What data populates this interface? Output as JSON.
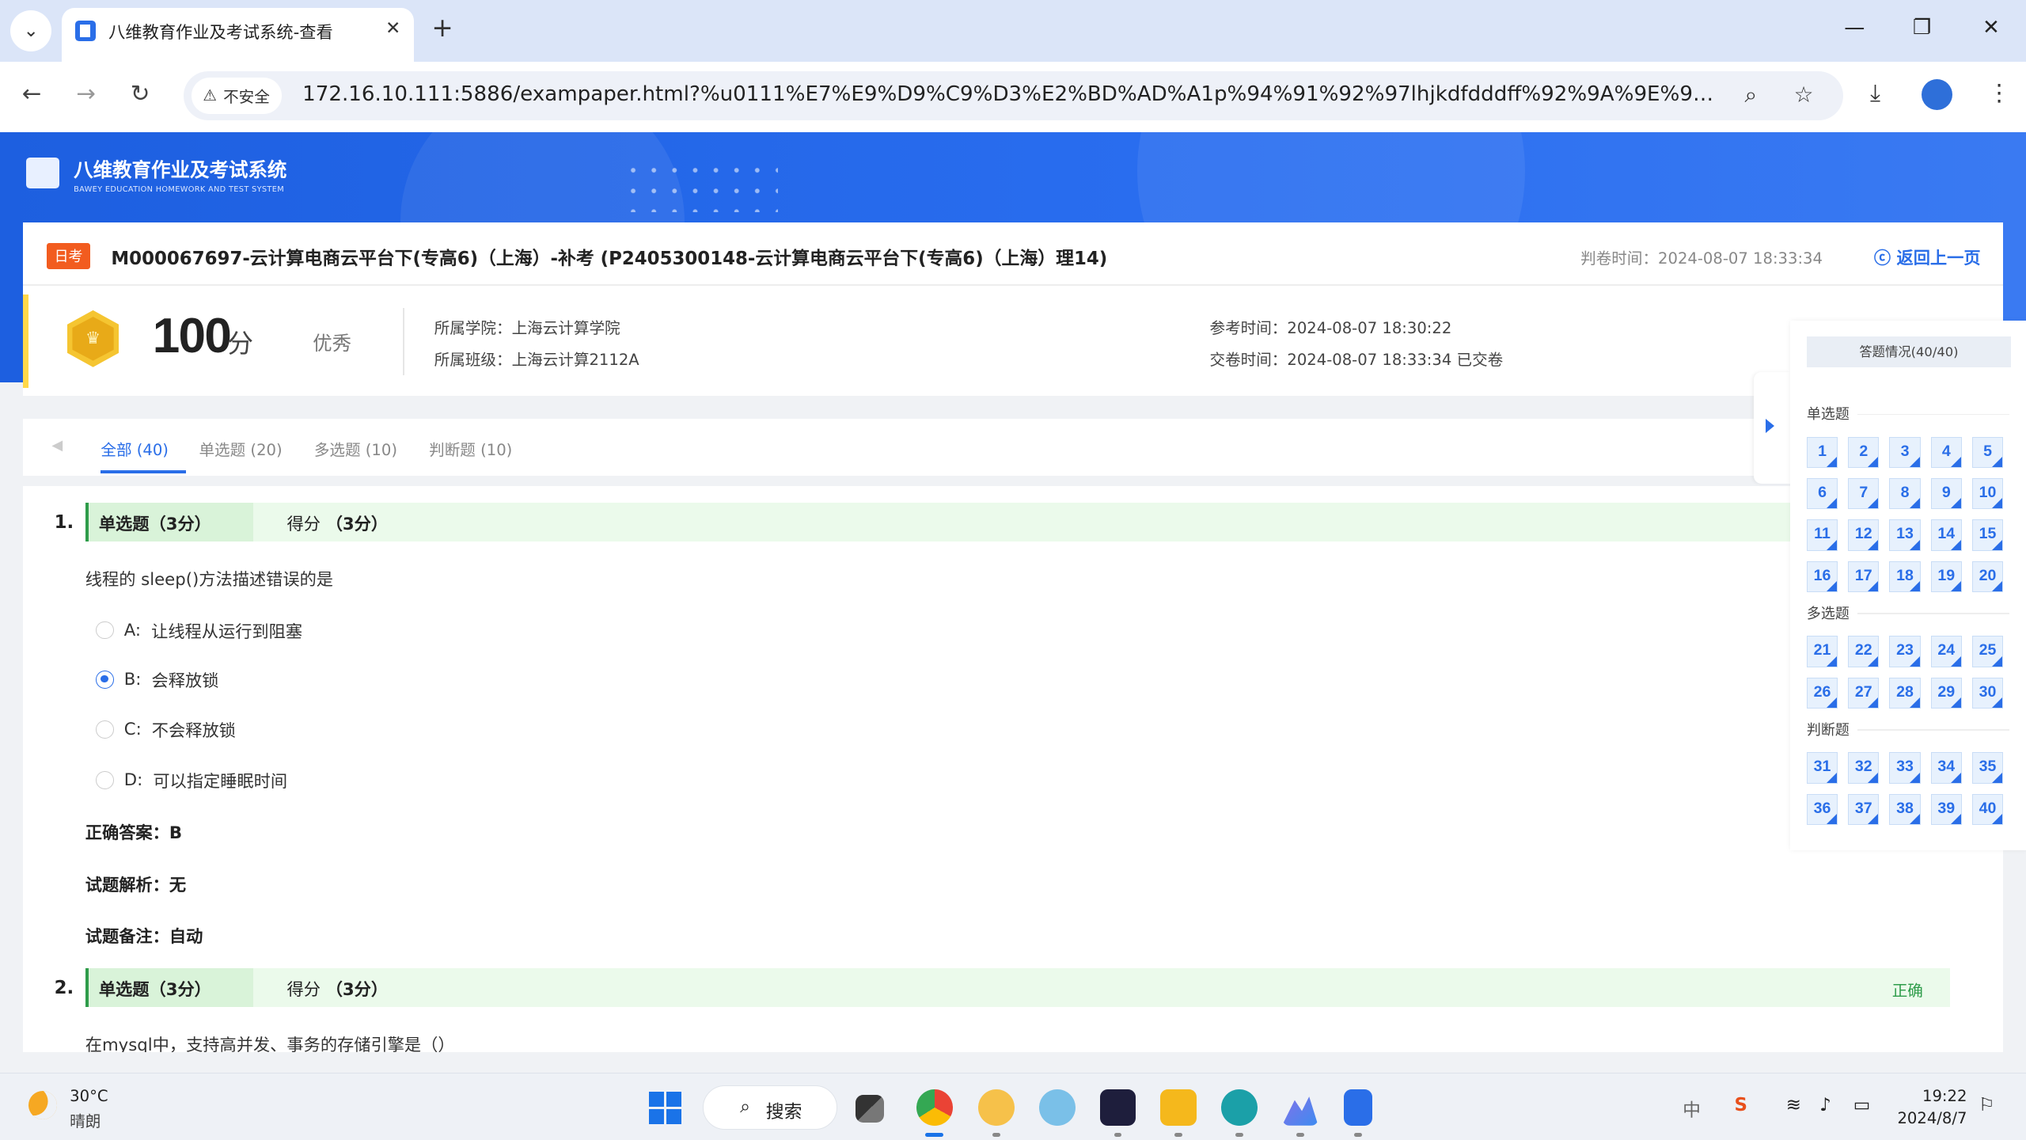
{
  "browser": {
    "tab_title": "八维教育作业及考试系统-查看",
    "security_label": "不安全",
    "url": "172.16.10.111:5886/exampaper.html?%u0111%E7%E9%D9%C9%D3%E2%BD%AD%A1p%94%91%92%97lhjkdfdddff%92%9A%9E%9Dlnr..."
  },
  "site": {
    "logo_title": "八维教育作业及考试系统",
    "logo_subtitle": "BAWEY EDUCATION HOMEWORK AND TEST SYSTEM"
  },
  "paper": {
    "badge": "日考",
    "title": "M000067697-云计算电商云平台下(专高6)（上海）-补考 (P2405300148-云计算电商云平台下(专高6)（上海）理14)",
    "judge_time": "判卷时间：2024-08-07 18:33:34",
    "back_label": "返回上一页",
    "score": "100",
    "score_unit": "分",
    "grade": "优秀",
    "college": "所属学院：上海云计算学院",
    "class": "所属班级：上海云计算2112A",
    "start_time": "参考时间：2024-08-07 18:30:22",
    "submit_time": "交卷时间：2024-08-07 18:33:34 已交卷"
  },
  "filter_tabs": [
    "全部 (40)",
    "单选题 (20)",
    "多选题 (10)",
    "判断题 (10)"
  ],
  "questions": [
    {
      "number": "1.",
      "type": "单选题（3分）",
      "score_label": "得分",
      "score_value": "（3分）",
      "status": "",
      "text": "线程的 sleep()方法描述错误的是",
      "options": [
        {
          "key": "A:",
          "text": "让线程从运行到阻塞",
          "selected": false
        },
        {
          "key": "B:",
          "text": "会释放锁",
          "selected": true
        },
        {
          "key": "C:",
          "text": "不会释放锁",
          "selected": false
        },
        {
          "key": "D:",
          "text": "可以指定睡眠时间",
          "selected": false
        }
      ],
      "answer": "正确答案：B",
      "analysis": "试题解析：无",
      "remark": "试题备注：自动"
    },
    {
      "number": "2.",
      "type": "单选题（3分）",
      "score_label": "得分",
      "score_value": "（3分）",
      "status": "正确",
      "text": "在mysql中，支持高并发、事务的存储引擎是（）"
    }
  ],
  "answer_sheet": {
    "title": "答题情况(40/40)",
    "sections": [
      {
        "label": "单选题",
        "numbers": [
          "1",
          "2",
          "3",
          "4",
          "5",
          "6",
          "7",
          "8",
          "9",
          "10",
          "11",
          "12",
          "13",
          "14",
          "15",
          "16",
          "17",
          "18",
          "19",
          "20"
        ]
      },
      {
        "label": "多选题",
        "numbers": [
          "21",
          "22",
          "23",
          "24",
          "25",
          "26",
          "27",
          "28",
          "29",
          "30"
        ]
      },
      {
        "label": "判断题",
        "numbers": [
          "31",
          "32",
          "33",
          "34",
          "35",
          "36",
          "37",
          "38",
          "39",
          "40"
        ]
      }
    ]
  },
  "taskbar": {
    "temperature": "30°C",
    "weather": "晴朗",
    "search_label": "搜索",
    "ime": "中",
    "time": "19:22",
    "date": "2024/8/7"
  },
  "colors": {
    "accent": "#2a6ee8",
    "correct_green": "#2e9c4a",
    "badge_orange": "#f25c1f",
    "banner_blue": "#1d5fe0"
  }
}
